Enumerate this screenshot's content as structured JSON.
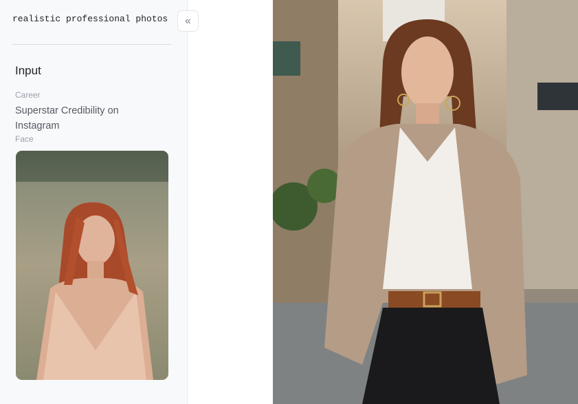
{
  "sidebar": {
    "prompt_text": "realistic professional photos",
    "collapse_icon": "chevrons-left-icon",
    "collapse_glyph": "«",
    "section_title": "Input",
    "fields": [
      {
        "label": "Career",
        "value": "Superstar Credibility on Instagram"
      },
      {
        "label": "Face"
      }
    ]
  },
  "colors": {
    "sidebar_bg": "#f8f9fb",
    "text_primary": "#222222",
    "label_gray": "#9aa0a8"
  }
}
